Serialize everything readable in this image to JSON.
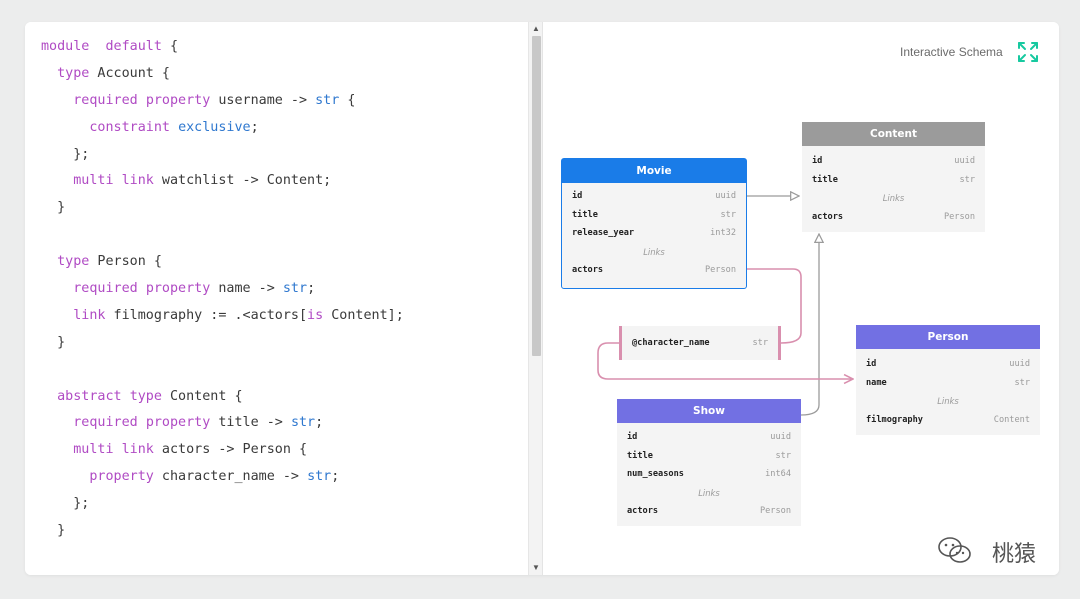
{
  "code": {
    "lines": [
      [
        [
          "kw",
          "module"
        ],
        [
          "",
          "  "
        ],
        [
          "kw",
          "default"
        ],
        [
          "",
          " {"
        ]
      ],
      [
        [
          "",
          "  "
        ],
        [
          "kw",
          "type"
        ],
        [
          "",
          " Account {"
        ]
      ],
      [
        [
          "",
          "    "
        ],
        [
          "kw",
          "required"
        ],
        [
          "",
          " "
        ],
        [
          "kw",
          "property"
        ],
        [
          "",
          " username -> "
        ],
        [
          "ty",
          "str"
        ],
        [
          "",
          " {"
        ]
      ],
      [
        [
          "",
          "      "
        ],
        [
          "kw",
          "constraint"
        ],
        [
          "",
          " "
        ],
        [
          "ty",
          "exclusive"
        ],
        [
          "",
          ";"
        ]
      ],
      [
        [
          "",
          "    };"
        ]
      ],
      [
        [
          "",
          "    "
        ],
        [
          "kw",
          "multi"
        ],
        [
          "",
          " "
        ],
        [
          "kw",
          "link"
        ],
        [
          "",
          " watchlist -> Content;"
        ]
      ],
      [
        [
          "",
          "  }"
        ]
      ],
      [
        [
          "",
          ""
        ]
      ],
      [
        [
          "",
          "  "
        ],
        [
          "kw",
          "type"
        ],
        [
          "",
          " Person {"
        ]
      ],
      [
        [
          "",
          "    "
        ],
        [
          "kw",
          "required"
        ],
        [
          "",
          " "
        ],
        [
          "kw",
          "property"
        ],
        [
          "",
          " name -> "
        ],
        [
          "ty",
          "str"
        ],
        [
          "",
          ";"
        ]
      ],
      [
        [
          "",
          "    "
        ],
        [
          "kw",
          "link"
        ],
        [
          "",
          " filmography := .<actors["
        ],
        [
          "kw",
          "is"
        ],
        [
          "",
          " Content];"
        ]
      ],
      [
        [
          "",
          "  }"
        ]
      ],
      [
        [
          "",
          ""
        ]
      ],
      [
        [
          "",
          "  "
        ],
        [
          "kw",
          "abstract"
        ],
        [
          "",
          " "
        ],
        [
          "kw",
          "type"
        ],
        [
          "",
          " Content {"
        ]
      ],
      [
        [
          "",
          "    "
        ],
        [
          "kw",
          "required"
        ],
        [
          "",
          " "
        ],
        [
          "kw",
          "property"
        ],
        [
          "",
          " title -> "
        ],
        [
          "ty",
          "str"
        ],
        [
          "",
          ";"
        ]
      ],
      [
        [
          "",
          "    "
        ],
        [
          "kw",
          "multi"
        ],
        [
          "",
          " "
        ],
        [
          "kw",
          "link"
        ],
        [
          "",
          " actors -> Person {"
        ]
      ],
      [
        [
          "",
          "      "
        ],
        [
          "kw",
          "property"
        ],
        [
          "",
          " character_name -> "
        ],
        [
          "ty",
          "str"
        ],
        [
          "",
          ";"
        ]
      ],
      [
        [
          "",
          "    };"
        ]
      ],
      [
        [
          "",
          "  }"
        ]
      ]
    ]
  },
  "schema": {
    "title": "Interactive Schema",
    "colors": {
      "blue": "#1a7ce8",
      "purple": "#7270e3",
      "gray": "#9b9b9b",
      "pink": "#d98fae",
      "green": "#17c9a0"
    },
    "boxes": {
      "movie": {
        "name": "Movie",
        "fields": [
          {
            "name": "id",
            "type": "uuid"
          },
          {
            "name": "title",
            "type": "str"
          },
          {
            "name": "release_year",
            "type": "int32"
          }
        ],
        "links_label": "Links",
        "links": [
          {
            "name": "actors",
            "type": "Person"
          }
        ]
      },
      "content": {
        "name": "Content",
        "fields": [
          {
            "name": "id",
            "type": "uuid"
          },
          {
            "name": "title",
            "type": "str"
          }
        ],
        "links_label": "Links",
        "links": [
          {
            "name": "actors",
            "type": "Person"
          }
        ]
      },
      "person": {
        "name": "Person",
        "fields": [
          {
            "name": "id",
            "type": "uuid"
          },
          {
            "name": "name",
            "type": "str"
          }
        ],
        "links_label": "Links",
        "links": [
          {
            "name": "filmography",
            "type": "Content"
          }
        ]
      },
      "show": {
        "name": "Show",
        "fields": [
          {
            "name": "id",
            "type": "uuid"
          },
          {
            "name": "title",
            "type": "str"
          },
          {
            "name": "num_seasons",
            "type": "int64"
          }
        ],
        "links_label": "Links",
        "links": [
          {
            "name": "actors",
            "type": "Person"
          }
        ]
      },
      "link_prop": {
        "field": {
          "name": "@character_name",
          "type": "str"
        }
      }
    }
  },
  "watermark": {
    "icon": "wechat-icon",
    "text": "桃猿"
  }
}
